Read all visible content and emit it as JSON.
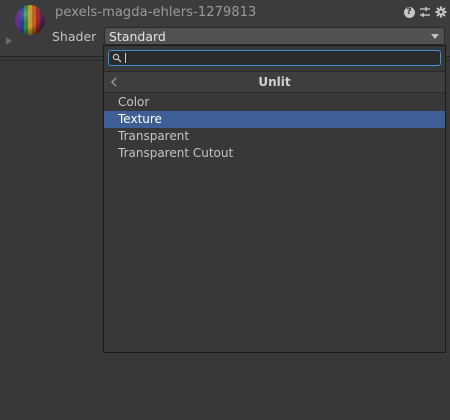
{
  "header": {
    "material_name": "pexels-magda-ehlers-1279813",
    "shader_label": "Shader",
    "shader_value": "Standard",
    "icons": [
      "help-icon",
      "settings-sliders-icon",
      "gear-icon"
    ]
  },
  "popup": {
    "search_value": "",
    "category_title": "Unlit",
    "items": [
      {
        "label": "Color",
        "selected": false
      },
      {
        "label": "Texture",
        "selected": true
      },
      {
        "label": "Transparent",
        "selected": false
      },
      {
        "label": "Transparent Cutout",
        "selected": false
      }
    ]
  },
  "colors": {
    "background": "#383838",
    "selection": "#3e5f96",
    "search_focus": "#3f8fdb"
  }
}
